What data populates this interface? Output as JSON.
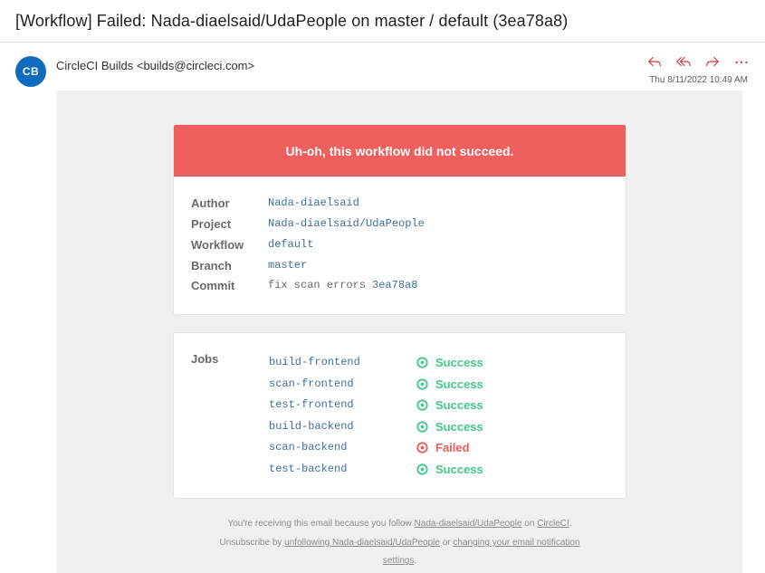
{
  "email": {
    "subject": "[Workflow] Failed: Nada-diaelsaid/UdaPeople on master / default (3ea78a8)",
    "avatar_initials": "CB",
    "sender": "CircleCI Builds <builds@circleci.com>",
    "date": "Thu 8/11/2022 10:49 AM",
    "actions": [
      {
        "icon": "reply-icon"
      },
      {
        "icon": "reply-all-icon"
      },
      {
        "icon": "forward-icon"
      },
      {
        "icon": "more-icon"
      }
    ]
  },
  "banner": {
    "text": "Uh-oh, this workflow did not succeed.",
    "color": "#ef5f5e"
  },
  "details": {
    "author_label": "Author",
    "author": "Nada-diaelsaid",
    "project_label": "Project",
    "project": "Nada-diaelsaid/UdaPeople",
    "workflow_label": "Workflow",
    "workflow": "default",
    "branch_label": "Branch",
    "branch": "master",
    "commit_label": "Commit",
    "commit_msg": "fix scan errors",
    "commit_hash": "3ea78a8"
  },
  "jobs": {
    "label": "Jobs",
    "items": [
      {
        "name": "build-frontend",
        "status": "Success"
      },
      {
        "name": "scan-frontend",
        "status": "Success"
      },
      {
        "name": "test-frontend",
        "status": "Success"
      },
      {
        "name": "build-backend",
        "status": "Success"
      },
      {
        "name": "scan-backend",
        "status": "Failed"
      },
      {
        "name": "test-backend",
        "status": "Success"
      }
    ]
  },
  "colors": {
    "success": "#42c88a",
    "failed": "#ed5c5c",
    "accent": "#0f6cbd"
  },
  "footer": {
    "line1_pre": "You're receiving this email because you follow ",
    "line1_link": "Nada-diaelsaid/UdaPeople",
    "line1_mid": " on ",
    "line1_link2": "CircleCI",
    "line1_post": ".",
    "line2_pre": "Unsubscribe by ",
    "line2_link": "unfollowing Nada-diaelsaid/UdaPeople",
    "line2_mid": " or ",
    "line2_link2": "changing your email notification",
    "line3_link": "settings",
    "line3_post": "."
  }
}
